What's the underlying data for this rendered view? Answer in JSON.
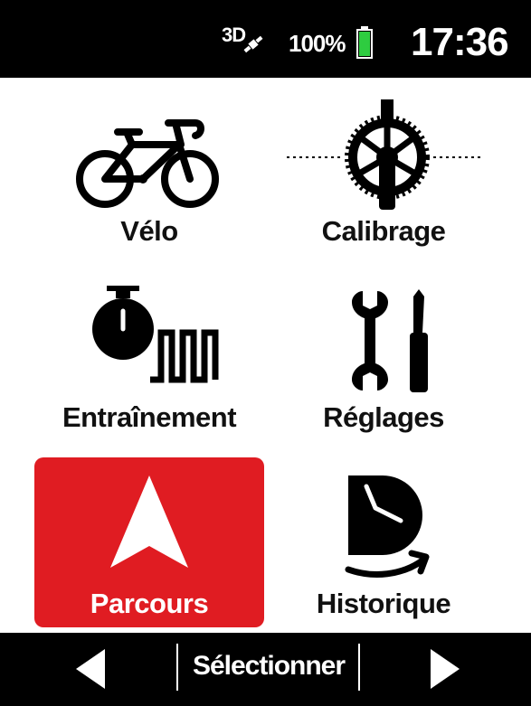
{
  "status_bar": {
    "gps_label": "3D",
    "battery_percent": "100%",
    "battery_level": 1.0,
    "time": "17:36"
  },
  "menu": {
    "items": [
      {
        "label": "Vélo",
        "icon": "bike-icon"
      },
      {
        "label": "Calibrage",
        "icon": "crankset-icon"
      },
      {
        "label": "Entraînement",
        "icon": "stopwatch-intervals-icon"
      },
      {
        "label": "Réglages",
        "icon": "wrench-screwdriver-icon"
      },
      {
        "label": "Parcours",
        "icon": "navigation-arrow-icon",
        "selected": true
      },
      {
        "label": "Historique",
        "icon": "history-clock-icon"
      }
    ]
  },
  "bottom_bar": {
    "select_label": "Sélectionner"
  },
  "colors": {
    "selected": "#e01c22",
    "battery": "#2ecc40",
    "bar": "#000000"
  }
}
